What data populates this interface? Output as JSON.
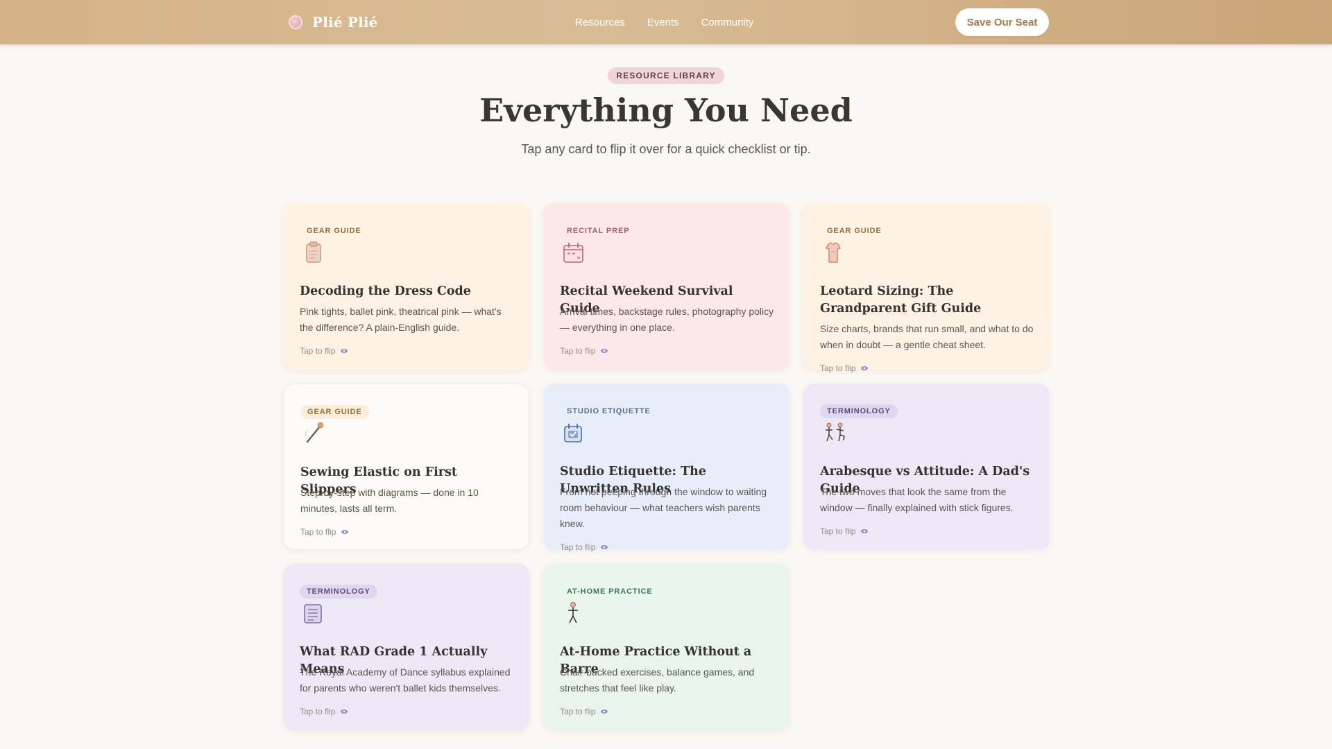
{
  "header": {
    "brand": "Plié Plié",
    "nav": [
      "Resources",
      "Events",
      "Community"
    ],
    "cta": "Save Our Seat"
  },
  "hero": {
    "eyebrow": "RESOURCE LIBRARY",
    "title": "Everything You Need",
    "subtitle": "Tap any card to flip it over for a quick checklist or tip."
  },
  "flip_label": "Tap to flip",
  "cards": [
    {
      "tag": "GEAR GUIDE",
      "icon": "clipboard-icon",
      "title": "Decoding the Dress Code",
      "desc": "Pink tights, ballet pink, theatrical pink — what's the difference? A plain-English guide."
    },
    {
      "tag": "RECITAL PREP",
      "icon": "calendar-icon",
      "title": "Recital Weekend Survival Guide",
      "desc": "Arrival times, backstage rules, photography policy — everything in one place."
    },
    {
      "tag": "GEAR GUIDE",
      "icon": "leotard-icon",
      "title": "Leotard Sizing: The Grandparent Gift Guide",
      "desc": "Size charts, brands that run small, and what to do when in doubt — a gentle cheat sheet."
    },
    {
      "tag": "GEAR GUIDE",
      "icon": "needle-icon",
      "title": "Sewing Elastic on First Slippers",
      "desc": "Step-by-step with diagrams — done in 10 minutes, lasts all term."
    },
    {
      "tag": "STUDIO ETIQUETTE",
      "icon": "calendar-check-icon",
      "title": "Studio Etiquette: The Unwritten Rules",
      "desc": "From not peeping through the window to waiting room behaviour — what teachers wish parents knew."
    },
    {
      "tag": "TERMINOLOGY",
      "icon": "stick-figures-icon",
      "title": "Arabesque vs Attitude: A Dad's Guide",
      "desc": "The two moves that look the same from the window — finally explained with stick figures."
    },
    {
      "tag": "TERMINOLOGY",
      "icon": "notebook-icon",
      "title": "What RAD Grade 1 Actually Means",
      "desc": "The Royal Academy of Dance syllabus explained for parents who weren't ballet kids themselves."
    },
    {
      "tag": "AT-HOME PRACTICE",
      "icon": "stick-figure-icon",
      "title": "At-Home Practice Without a Barre",
      "desc": "Chair-backed exercises, balance games, and stretches that feel like play."
    }
  ]
}
